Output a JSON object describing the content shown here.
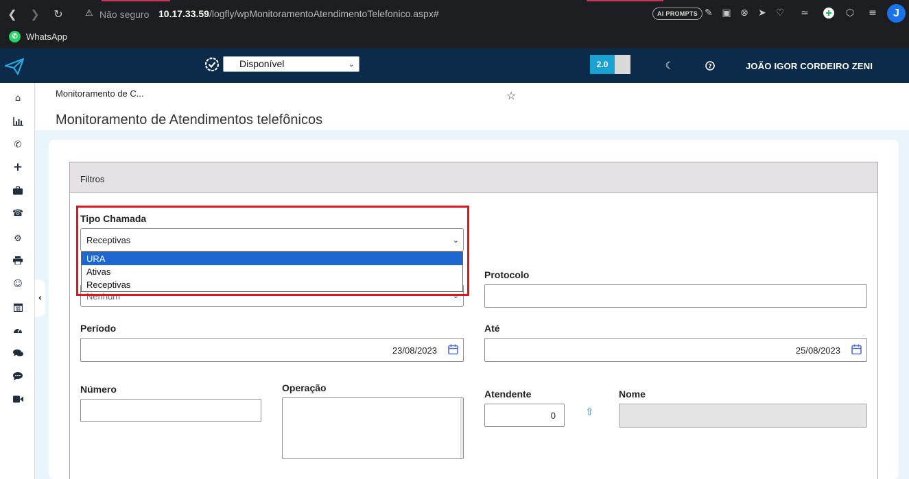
{
  "browser": {
    "security_label": "Não seguro",
    "url_host": "10.17.33.59",
    "url_path": "/logfly/wpMonitoramentoAtendimentoTelefonico.aspx#",
    "ai_prompts_label": "AI PROMPTS",
    "profile_initial": "J",
    "bookmark_label": "WhatsApp",
    "accent_color": "#c7375b"
  },
  "header": {
    "status_value": "Disponível",
    "version_label": "2.0",
    "user_name": "JOÃO IGOR CORDEIRO ZENI",
    "background_color": "#0c2b4b"
  },
  "sidebar": {
    "items": [
      {
        "icon": "home-icon"
      },
      {
        "icon": "bar-chart-icon"
      },
      {
        "icon": "whatsapp-icon"
      },
      {
        "icon": "plus-icon"
      },
      {
        "icon": "briefcase-icon"
      },
      {
        "icon": "phone-icon"
      },
      {
        "icon": "gear-icon"
      },
      {
        "icon": "printer-icon"
      },
      {
        "icon": "smile-icon"
      },
      {
        "icon": "calendar-icon"
      },
      {
        "icon": "dashboard-icon"
      },
      {
        "icon": "comments-icon"
      },
      {
        "icon": "comment-dots-icon"
      },
      {
        "icon": "video-icon"
      }
    ]
  },
  "page": {
    "breadcrumb": "Monitoramento de C...",
    "title": "Monitoramento de Atendimentos telefônicos"
  },
  "filters": {
    "panel_title": "Filtros",
    "tipo_chamada": {
      "label": "Tipo Chamada",
      "value": "Receptivas",
      "options": [
        "URA",
        "Ativas",
        "Receptivas"
      ],
      "highlighted_option": "URA"
    },
    "hidden_select_value": "Nenhum",
    "protocolo": {
      "label": "Protocolo",
      "value": ""
    },
    "periodo": {
      "label": "Período",
      "value": "23/08/2023"
    },
    "ate": {
      "label": "Até",
      "value": "25/08/2023"
    },
    "numero": {
      "label": "Número",
      "value": ""
    },
    "operacao": {
      "label": "Operação",
      "value": ""
    },
    "atendente": {
      "label": "Atendente",
      "value": "0"
    },
    "nome": {
      "label": "Nome",
      "value": ""
    }
  }
}
